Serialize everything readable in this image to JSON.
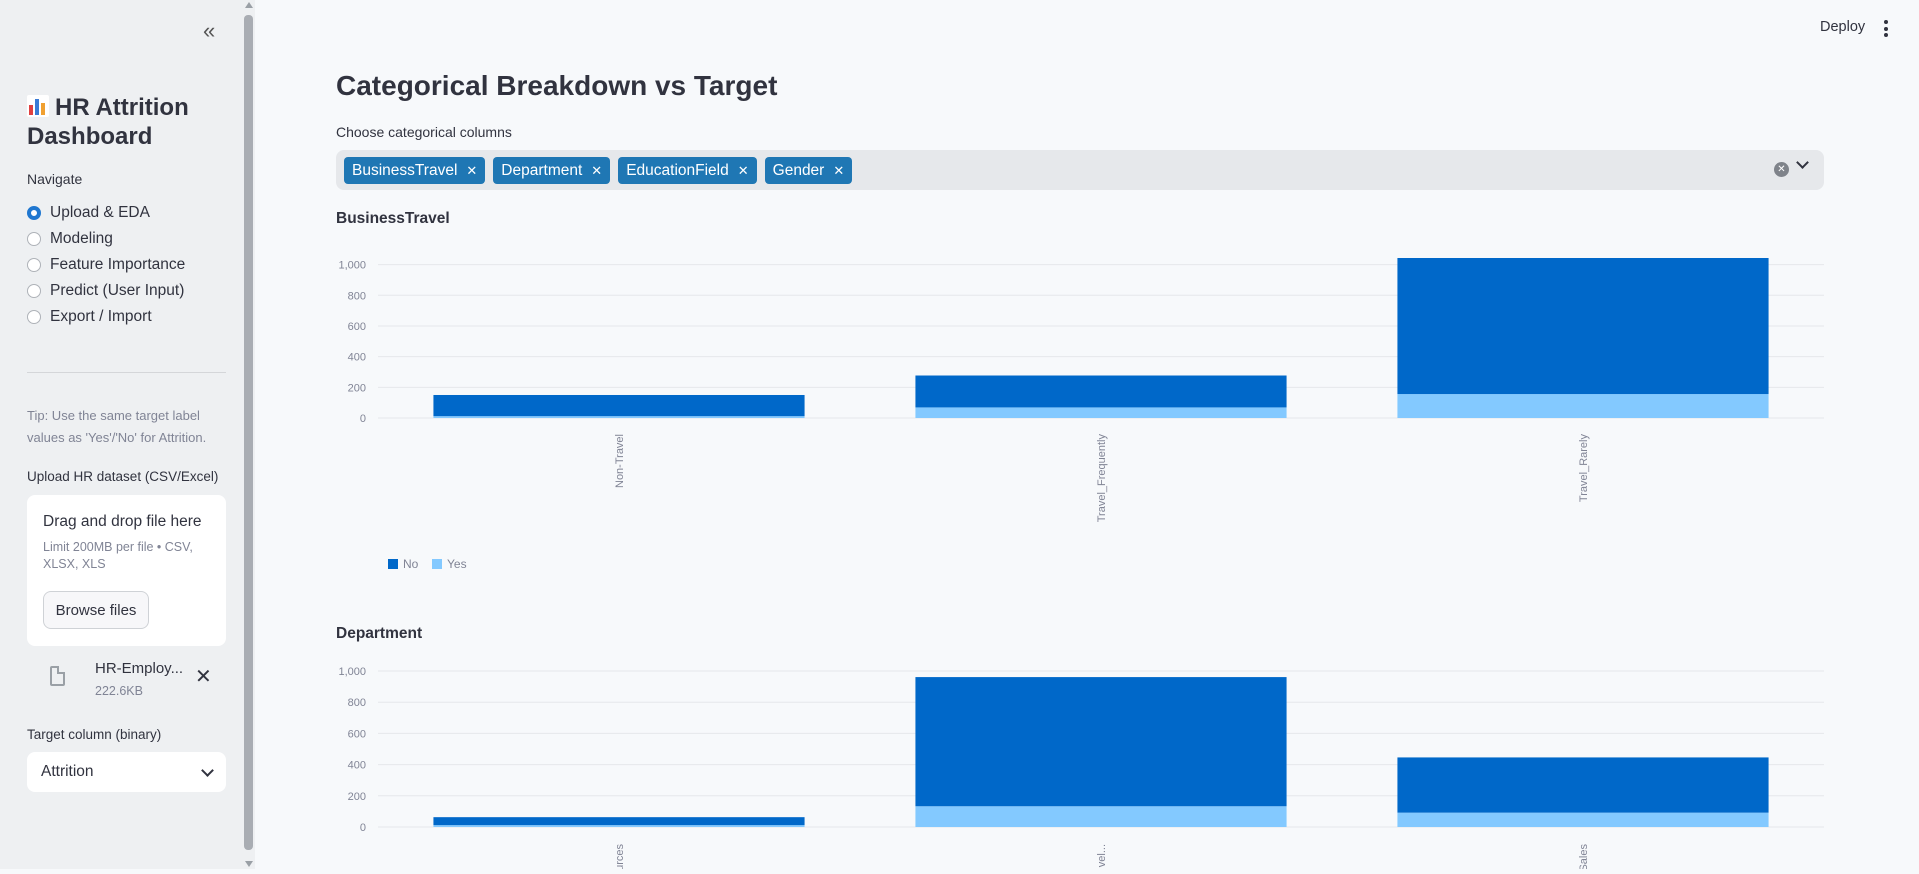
{
  "sidebar": {
    "title": "HR Attrition Dashboard",
    "nav_label": "Navigate",
    "nav_items": [
      {
        "label": "Upload & EDA",
        "selected": true
      },
      {
        "label": "Modeling",
        "selected": false
      },
      {
        "label": "Feature Importance",
        "selected": false
      },
      {
        "label": "Predict (User Input)",
        "selected": false
      },
      {
        "label": "Export / Import",
        "selected": false
      }
    ],
    "tip": "Tip: Use the same target label values as 'Yes'/'No' for Attrition.",
    "upload": {
      "label": "Upload HR dataset (CSV/Excel)",
      "drop_title": "Drag and drop file here",
      "limit": "Limit 200MB per file • CSV, XLSX, XLS",
      "browse_label": "Browse files",
      "file_name": "HR-Employ...",
      "file_size": "222.6KB"
    },
    "target": {
      "label": "Target column (binary)",
      "value": "Attrition"
    }
  },
  "header": {
    "deploy_label": "Deploy"
  },
  "main": {
    "title": "Categorical Breakdown vs Target",
    "multiselect_label": "Choose categorical columns",
    "selected_columns": [
      "BusinessTravel",
      "Department",
      "EducationField",
      "Gender"
    ]
  },
  "chart_data": [
    {
      "type": "bar",
      "stacked": true,
      "title": "BusinessTravel",
      "categories": [
        "Non-Travel",
        "Travel_Frequently",
        "Travel_Rarely"
      ],
      "series": [
        {
          "name": "No",
          "values": [
            138,
            208,
            887
          ],
          "color": "#0068c9"
        },
        {
          "name": "Yes",
          "values": [
            12,
            69,
            156
          ],
          "color": "#83c9ff"
        }
      ],
      "yticks": [
        "0",
        "200",
        "400",
        "600",
        "800",
        "1,000"
      ],
      "ylim": [
        0,
        1043
      ],
      "legend": "bottom-left",
      "grid": true
    },
    {
      "type": "bar",
      "stacked": true,
      "title": "Department",
      "categories": [
        "Human Resources",
        "Research & Development",
        "Sales"
      ],
      "category_labels": [
        "urces",
        "vel...",
        "Sales"
      ],
      "series": [
        {
          "name": "No",
          "values": [
            51,
            828,
            354
          ],
          "color": "#0068c9"
        },
        {
          "name": "Yes",
          "values": [
            12,
            133,
            92
          ],
          "color": "#83c9ff"
        }
      ],
      "yticks": [
        "0",
        "200",
        "400",
        "600",
        "800",
        "1,000"
      ],
      "ylim": [
        0,
        1000
      ],
      "grid": true
    }
  ]
}
